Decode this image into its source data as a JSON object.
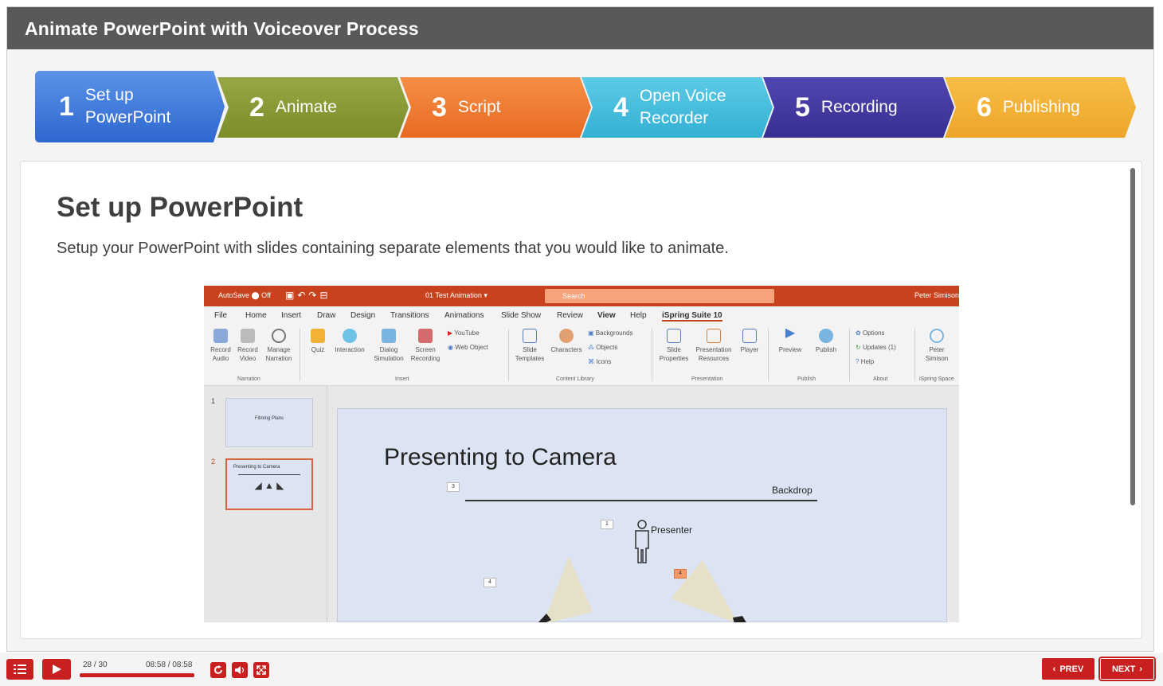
{
  "title": "Animate PowerPoint with Voiceover Process",
  "steps": [
    {
      "num": "1",
      "label_line1": "Set up",
      "label_line2": "PowerPoint"
    },
    {
      "num": "2",
      "label": "Animate"
    },
    {
      "num": "3",
      "label": "Script"
    },
    {
      "num": "4",
      "label_line1": "Open Voice",
      "label_line2": "Recorder"
    },
    {
      "num": "5",
      "label": "Recording"
    },
    {
      "num": "6",
      "label": "Publishing"
    }
  ],
  "content": {
    "heading": "Set up PowerPoint",
    "description": "Setup your PowerPoint with slides containing separate elements that you would like to animate."
  },
  "screenshot": {
    "autosave": "AutoSave",
    "autosave_state": "Off",
    "filename": "01 Test Animation",
    "search_placeholder": "Search",
    "user": "Peter Simison",
    "tabs": [
      "File",
      "Home",
      "Insert",
      "Draw",
      "Design",
      "Transitions",
      "Animations",
      "Slide Show",
      "Review",
      "View",
      "Help",
      "iSpring Suite 10"
    ],
    "ribbon": {
      "record_audio": "Record Audio",
      "record_video": "Record Video",
      "manage_narration": "Manage Narration",
      "quiz": "Quiz",
      "interaction": "Interaction",
      "dialog_simulation": "Dialog Simulation",
      "screen_recording": "Screen Recording",
      "youtube": "YouTube",
      "web_object": "Web Object",
      "slide_templates": "Slide Templates",
      "characters": "Characters",
      "backgrounds": "Backgrounds",
      "objects": "Objects",
      "icons": "Icons",
      "slide_properties": "Slide Properties",
      "presentation_resources": "Presentation Resources",
      "player": "Player",
      "preview": "Preview",
      "publish": "Publish",
      "options": "Options",
      "updates": "Updates (1)",
      "help": "Help",
      "peter_simison": "Peter Simison",
      "groups": [
        "Narration",
        "Insert",
        "Content Library",
        "Presentation",
        "Publish",
        "About",
        "iSpring Space"
      ]
    },
    "thumb1_num": "1",
    "thumb1_text": "Filming Plans",
    "thumb2_num": "2",
    "thumb2_text": "Presenting to Camera",
    "slide_title": "Presenting to Camera",
    "backdrop": "Backdrop",
    "presenter": "Presenter",
    "tag_3": "3",
    "tag_1": "1",
    "tag_4a": "4",
    "tag_4b": "4"
  },
  "player": {
    "counter": "28 / 30",
    "time": "08:58 / 08:58",
    "progress": 1.0,
    "prev": "PREV",
    "next": "NEXT"
  },
  "colors": {
    "accent": "#c82020",
    "title_bar": "#595959"
  }
}
